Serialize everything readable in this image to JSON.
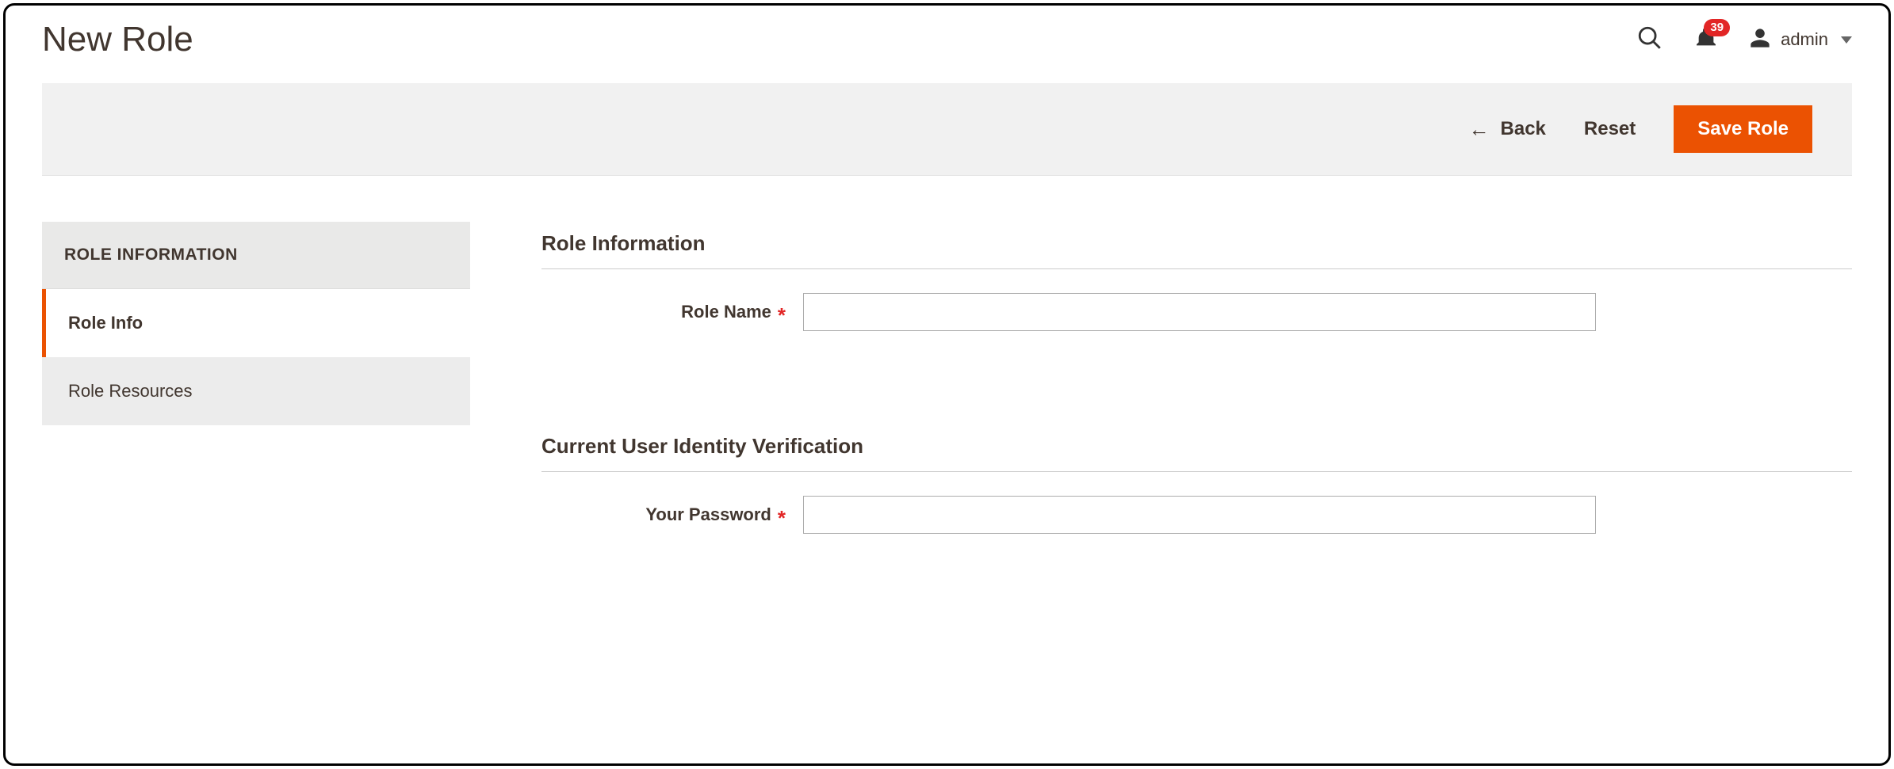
{
  "page": {
    "title": "New Role"
  },
  "header": {
    "notification_count": "39",
    "user_name": "admin"
  },
  "actions": {
    "back_label": "Back",
    "reset_label": "Reset",
    "save_label": "Save Role"
  },
  "sidebar": {
    "heading": "ROLE INFORMATION",
    "items": [
      {
        "label": "Role Info"
      },
      {
        "label": "Role Resources"
      }
    ]
  },
  "form": {
    "section1_heading": "Role Information",
    "role_name_label": "Role Name",
    "role_name_value": "",
    "section2_heading": "Current User Identity Verification",
    "password_label": "Your Password",
    "password_value": ""
  }
}
